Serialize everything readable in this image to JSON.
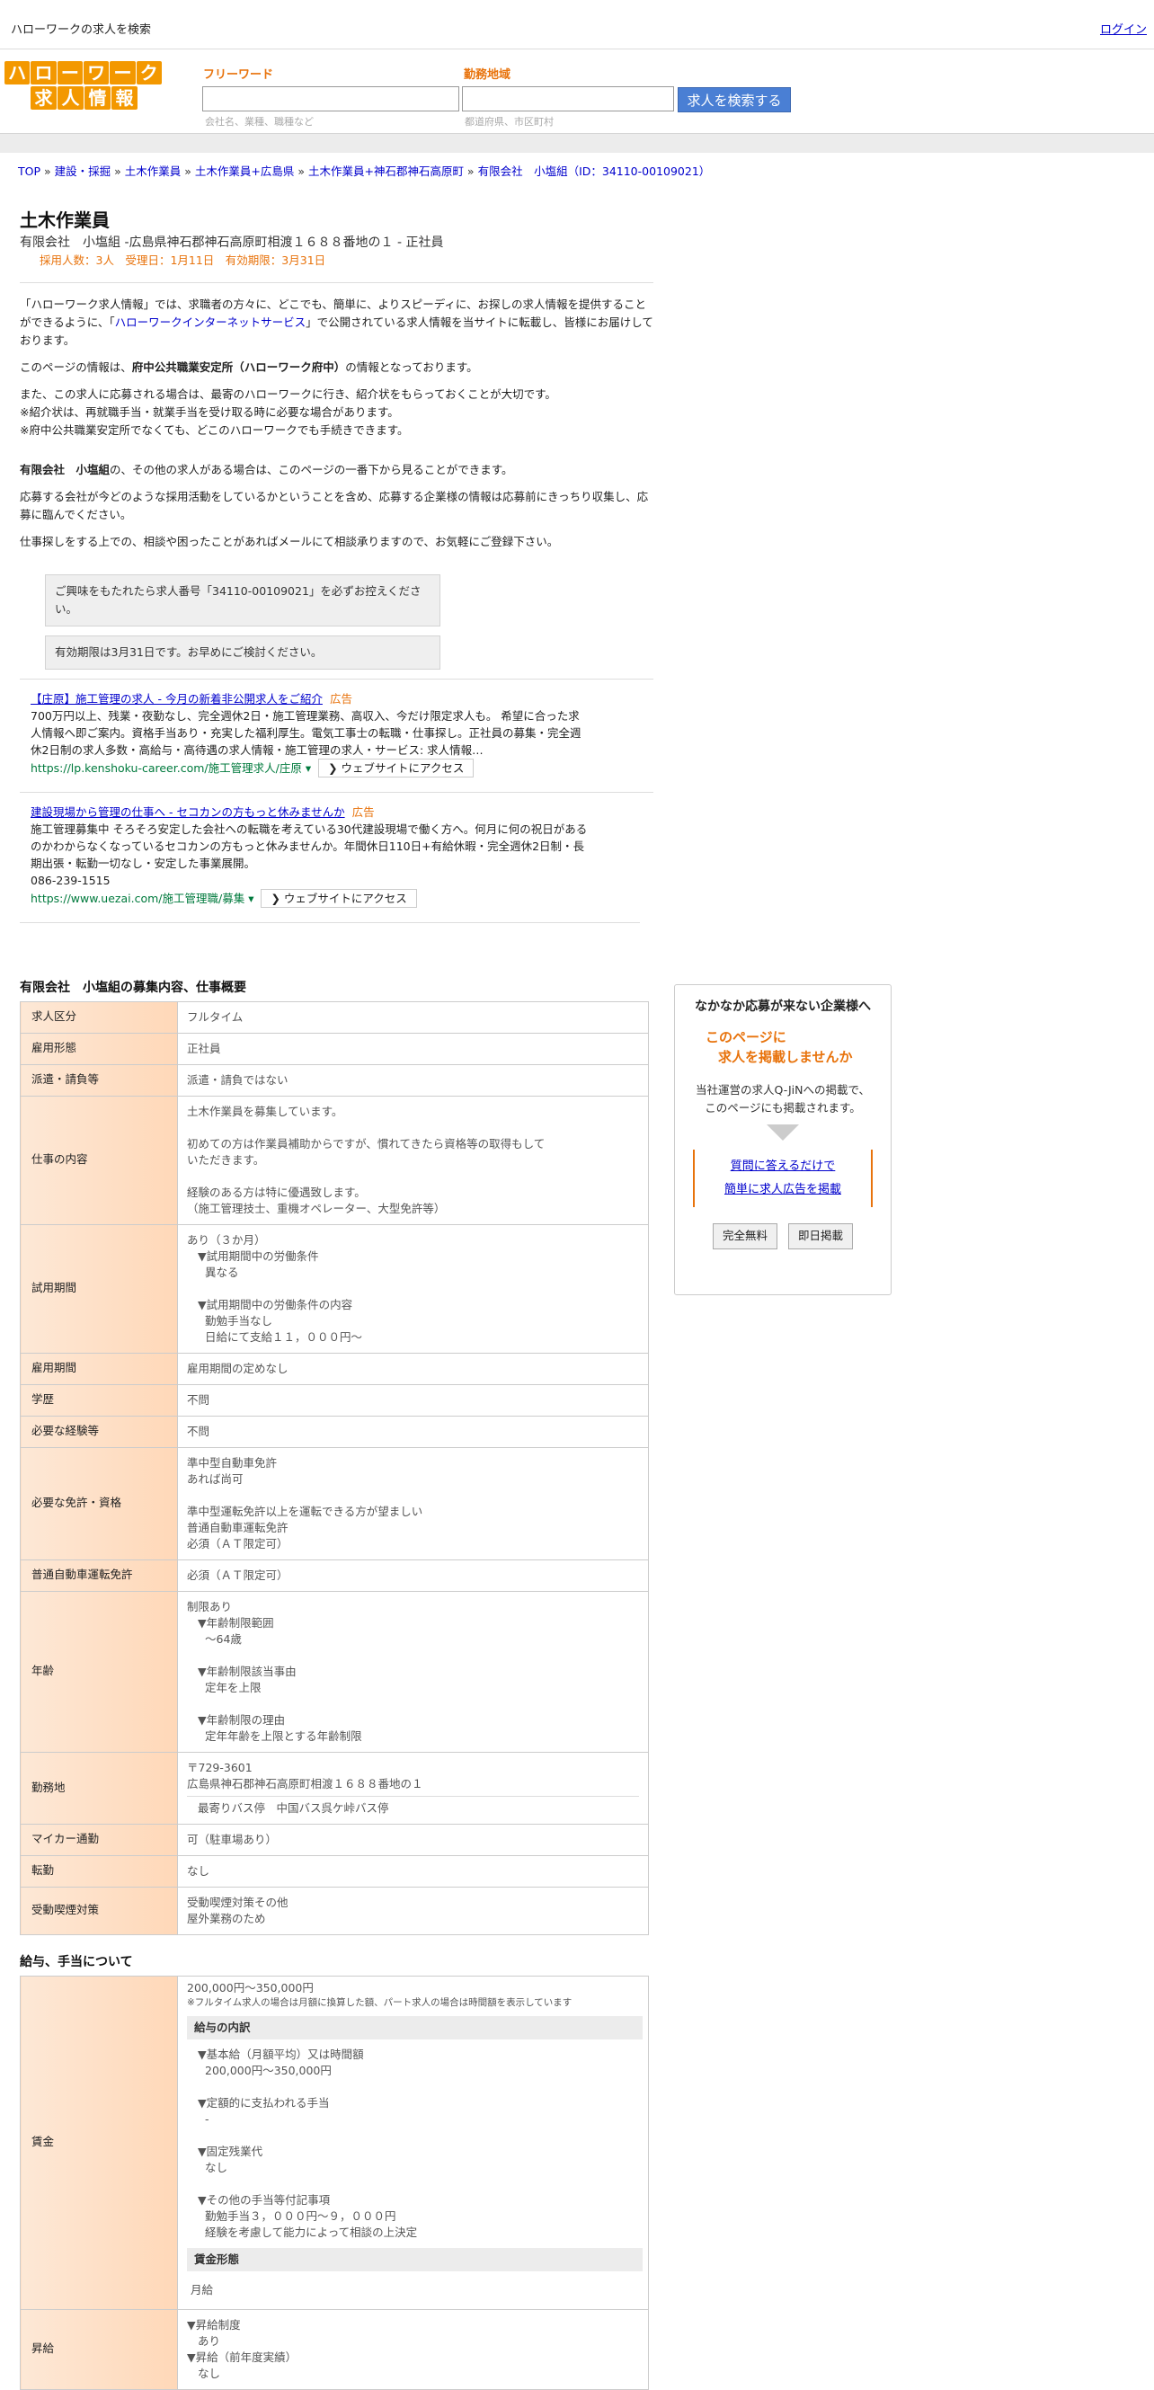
{
  "topbar": {
    "site_title": "ハローワークの求人を検索",
    "login": "ログイン"
  },
  "logo": {
    "row1": [
      "ハ",
      "ロ",
      "ー",
      "ワ",
      "ー",
      "ク"
    ],
    "row2": [
      "求",
      "人",
      "情",
      "報"
    ]
  },
  "search": {
    "freeword_label": "フリーワード",
    "freeword_placeholder": "会社名、業種、職種など",
    "location_label": "勤務地域",
    "location_placeholder": "都道府県、市区町村",
    "button": "求人を検索する"
  },
  "breadcrumb": [
    "TOP",
    "建設・採掘",
    "土木作業員",
    "土木作業員+広島県",
    "土木作業員+神石郡神石高原町",
    "有限会社　小塩組（ID：34110-00109021）"
  ],
  "job": {
    "title": "土木作業員",
    "company_line": "有限会社　小塩組 -広島県神石郡神石高原町相渡１６８８番地の１ - 正社員",
    "meta": "採用人数：3人　受理日：1月11日　有効期限：3月31日"
  },
  "intro": {
    "p1_a": "「ハローワーク求人情報」では、求職者の方々に、どこでも、簡単に、よりスピーディに、お探しの求人情報を提供することができるように、「",
    "p1_link": "ハローワークインターネットサービス",
    "p1_b": "」で公開されている求人情報を当サイトに転載し、皆様にお届けしております。",
    "p2_a": "このページの情報は、",
    "p2_bold": "府中公共職業安定所（ハローワーク府中）",
    "p2_b": "の情報となっております。",
    "p3_l1": "また、この求人に応募される場合は、最寄のハローワークに行き、紹介状をもらっておくことが大切です。",
    "p3_l2": "※紹介状は、再就職手当・就業手当を受け取る時に必要な場合があります。",
    "p3_l3": "※府中公共職業安定所でなくても、どこのハローワークでも手続きできます。",
    "p4_bold": "有限会社　小塩組",
    "p4_b": "の、その他の求人がある場合は、このページの一番下から見ることができます。",
    "p5": "応募する会社が今どのような採用活動をしているかということを含め、応募する企業様の情報は応募前にきっちり収集し、応募に臨んでください。",
    "p6": "仕事探しをする上での、相談や困ったことがあればメールにて相談承りますので、お気軽にご登録下さい。"
  },
  "notes": {
    "note1": "ご興味をもたれたら求人番号「34110-00109021」を必ずお控えください。",
    "note2": "有効期限は3月31日です。お早めにご検討ください。"
  },
  "ads": [
    {
      "title": "【庄原】施工管理の求人 - 今月の新着非公開求人をご紹介",
      "tag": "広告",
      "body": "700万円以上、残業・夜勤なし、完全週休2日・施工管理業務、高収入、今だけ限定求人も。 希望に合った求人情報へ即ご案内。資格手当あり・充実した福利厚生。電気工事士の転職・仕事探し。正社員の募集・完全週休2日制の求人多数・高給与・高待遇の求人情報・施工管理の求人・サービス: 求人情報…",
      "phone": "",
      "url": "https://lp.kenshoku-career.com/施工管理求人/庄原",
      "button": "❯ ウェブサイトにアクセス"
    },
    {
      "title": "建設現場から管理の仕事へ - セコカンの方もっと休みませんか",
      "tag": "広告",
      "body": "施工管理募集中 そろそろ安定した会社への転職を考えている30代建設現場で働く方へ。何月に何の祝日があるのかわからなくなっているセコカンの方もっと休みませんか。年間休日110日+有給休暇・完全週休2日制・長期出張・転勤一切なし・安定した事業展開。",
      "phone": "086-239-1515",
      "url": "https://www.uezai.com/施工管理職/募集",
      "button": "❯ ウェブサイトにアクセス"
    }
  ],
  "overview": {
    "title": "有限会社　小塩組の募集内容、仕事概要",
    "rows": {
      "kyujin_kubun": {
        "label": "求人区分",
        "value": "フルタイム"
      },
      "koyo_keitai": {
        "label": "雇用形態",
        "value": "正社員"
      },
      "haken": {
        "label": "派遣・請負等",
        "value": "派遣・請負ではない"
      },
      "shigoto": {
        "label": "仕事の内容",
        "l1": "土木作業員を募集しています。",
        "l2": "初めての方は作業員補助からですが、慣れてきたら資格等の取得もしていただきます。",
        "l3": "経験のある方は特に優遇致します。",
        "l4": "（施工管理技士、重機オペレーター、大型免許等）"
      },
      "shiyo": {
        "label": "試用期間",
        "l1": "あり（３か月）",
        "l2": "▼試用期間中の労働条件",
        "l3": "異なる",
        "l4": "▼試用期間中の労働条件の内容",
        "l5": "勤勉手当なし",
        "l6": "日給にて支給１１，０００円～"
      },
      "koyo_kikan": {
        "label": "雇用期間",
        "value": "雇用期間の定めなし"
      },
      "gakureki": {
        "label": "学歴",
        "value": "不問"
      },
      "keiken": {
        "label": "必要な経験等",
        "value": "不問"
      },
      "menkyo": {
        "label": "必要な免許・資格",
        "l1": "準中型自動車免許",
        "l2": "あれば尚可",
        "l3": "準中型運転免許以上を運転できる方が望ましい",
        "l4": "普通自動車運転免許",
        "l5": "必須（ＡＴ限定可）"
      },
      "futsu": {
        "label": "普通自動車運転免許",
        "value": "必須（ＡＴ限定可）"
      },
      "nenrei": {
        "label": "年齢",
        "l1": "制限あり",
        "l2": "▼年齢制限範囲",
        "l3": "〜64歳",
        "l4": "▼年齢制限該当事由",
        "l5": "定年を上限",
        "l6": "▼年齢制限の理由",
        "l7": "定年年齢を上限とする年齢制限"
      },
      "kinmuchi": {
        "label": "勤務地",
        "l1": "〒729-3601",
        "l2": "広島県神石郡神石高原町相渡１６８８番地の１",
        "l3": "最寄りバス停　中国バス呉ケ峠バス停"
      },
      "mycar": {
        "label": "マイカー通勤",
        "value": "可（駐車場あり）"
      },
      "tenkin": {
        "label": "転勤",
        "value": "なし"
      },
      "judo": {
        "label": "受動喫煙対策",
        "l1": "受動喫煙対策その他",
        "l2": "屋外業務のため"
      }
    }
  },
  "salary": {
    "title": "給与、手当について",
    "chingin": {
      "label": "賃金",
      "range": "200,000円〜350,000円",
      "note": "※フルタイム求人の場合は月額に換算した額、パート求人の場合は時間額を表示しています",
      "breakdown_head": "給与の内訳",
      "b1": "▼基本給（月額平均）又は時間額",
      "b2": "200,000円〜350,000円",
      "b3": "▼定額的に支払われる手当",
      "b4": "-",
      "b5": "▼固定残業代",
      "b6": "なし",
      "b7": "▼その他の手当等付記事項",
      "b8": "勤勉手当３，０００円～９，０００円",
      "b9": "経験を考慮して能力によって相談の上決定",
      "form_head": "賃金形態",
      "form": "月給"
    },
    "shokyu": {
      "label": "昇給",
      "l1": "▼昇給制度",
      "l2": "あり",
      "l3": "▼昇給（前年度実績）",
      "l4": "なし"
    }
  },
  "side": {
    "title": "なかなか応募が来ない企業様へ",
    "highlight1": "このページに",
    "highlight2": "求人を掲載しませんか",
    "text1": "当社運営の求人Q-JiNへの掲載で、",
    "text2": "このページにも掲載されます。",
    "link1": "質問に答えるだけで",
    "link2": "簡単に求人広告を掲載",
    "btn1": "完全無料",
    "btn2": "即日掲載"
  }
}
